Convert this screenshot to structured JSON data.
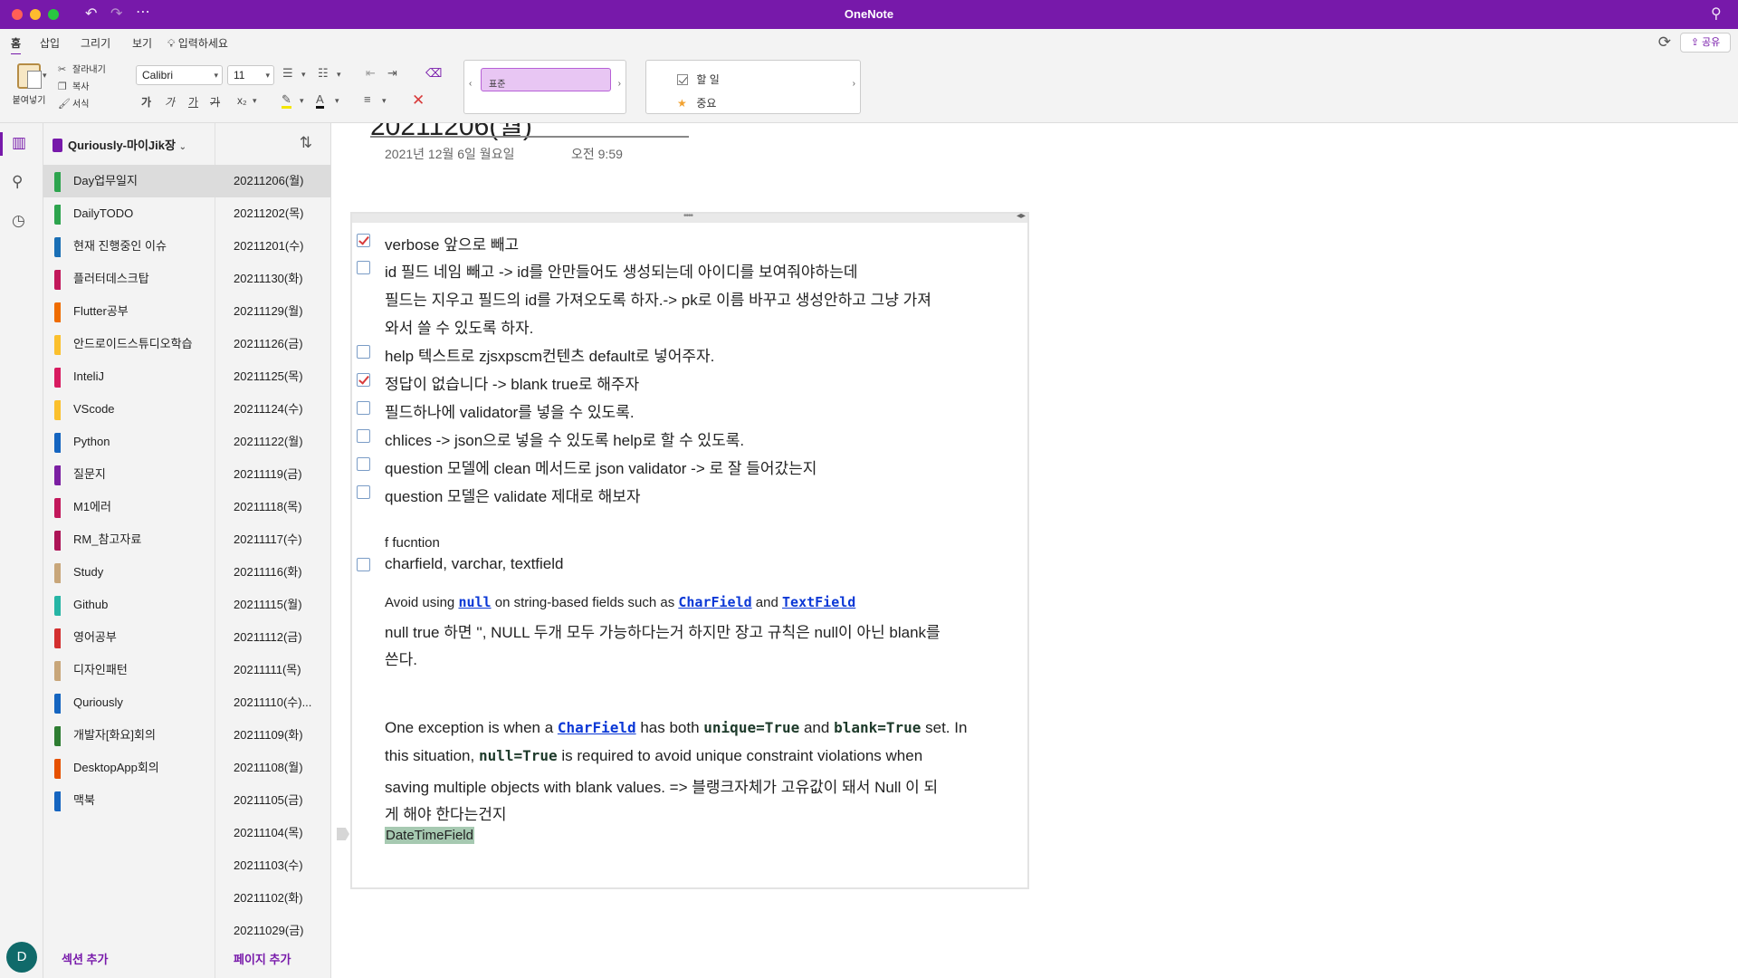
{
  "app": {
    "title": "OneNote"
  },
  "ribbon_tabs": [
    "홈",
    "삽입",
    "그리기",
    "보기"
  ],
  "tell_me": "입력하세요",
  "share_label": "공유",
  "clipboard": {
    "paste": "붙여넣기",
    "cut": "잘라내기",
    "copy": "복사",
    "format": "서식"
  },
  "font": {
    "family": "Calibri",
    "size": "11"
  },
  "format_buttons": [
    "가",
    "가",
    "가",
    "가",
    "x₂"
  ],
  "styles": {
    "selected": "표준"
  },
  "tags": [
    {
      "label": "할 일",
      "icon": "checkbox-icon"
    },
    {
      "label": "중요",
      "icon": "star-icon"
    }
  ],
  "notebook": {
    "name": "Quriously-마이Jik장"
  },
  "sections": [
    {
      "name": "Day업무일지",
      "color": "#2da44e"
    },
    {
      "name": "DailyTODO",
      "color": "#2da44e"
    },
    {
      "name": "현재 진행중인 이슈",
      "color": "#1a6fb5"
    },
    {
      "name": "플러터데스크탑",
      "color": "#c2185b"
    },
    {
      "name": "Flutter공부",
      "color": "#ef6c00"
    },
    {
      "name": "안드로이드스튜디오학습",
      "color": "#fbc02d"
    },
    {
      "name": "InteliJ",
      "color": "#d81b60"
    },
    {
      "name": "VScode",
      "color": "#fbc02d"
    },
    {
      "name": "Python",
      "color": "#1565c0"
    },
    {
      "name": "질문지",
      "color": "#7b1fa2"
    },
    {
      "name": "M1에러",
      "color": "#c2185b"
    },
    {
      "name": "RM_참고자료",
      "color": "#ad1457"
    },
    {
      "name": "Study",
      "color": "#c8a67a"
    },
    {
      "name": "Github",
      "color": "#26b5a5"
    },
    {
      "name": "영어공부",
      "color": "#d32f2f"
    },
    {
      "name": "디자인패턴",
      "color": "#c8a67a"
    },
    {
      "name": "Quriously",
      "color": "#1565c0"
    },
    {
      "name": "개발자[화요]회의",
      "color": "#2e7d32"
    },
    {
      "name": "DesktopApp회의",
      "color": "#e65100"
    },
    {
      "name": "맥북",
      "color": "#1565c0"
    }
  ],
  "add_section": "섹션 추가",
  "pages": [
    "20211206(월)",
    "20211202(목)",
    "20211201(수)",
    "20211130(화)",
    "20211129(월)",
    "20211126(금)",
    "20211125(목)",
    "20211124(수)",
    "20211122(월)",
    "20211119(금)",
    "20211118(목)",
    "20211117(수)",
    "20211116(화)",
    "20211115(월)",
    "20211112(금)",
    "20211111(목)",
    "20211110(수)...",
    "20211109(화)",
    "20211108(월)",
    "20211105(금)",
    "20211104(목)",
    "20211103(수)",
    "20211102(화)",
    "20211029(금)"
  ],
  "add_page": "페이지 추가",
  "page": {
    "title": "20211206(월)",
    "date": "2021년 12월 6일 월요일",
    "time": "오전 9:59"
  },
  "note": {
    "todo_1": "verbose 앞으로 빼고",
    "todo_2": "id 필드 네임 빼고 -> id를 안만들어도 생성되는데 아이디를 보여줘야하는데",
    "todo_2_cont_1": "필드는 지우고 필드의 id를 가져오도록 하자.-> pk로 이름 바꾸고 생성안하고 그냥 가져",
    "todo_2_cont_2": "와서 쓸 수 있도록 하자.",
    "todo_3": "help 텍스트로 zjsxpscm컨텐츠 default로 넣어주자.",
    "todo_4": "정답이 없습니다 -> blank true로 해주자",
    "todo_5": "필드하나에 validator를 넣을 수 있도록.",
    "todo_6": "chlices -> json으로 넣을 수 있도록 help로 할 수 있도록.",
    "todo_7": "question 모델에 clean 메서드로 json validator -> 로 잘 들어갔는지",
    "todo_8": "question 모델은 validate 제대로 해보자",
    "fn_label": "f fucntion",
    "fn_types": "charfield, varchar, textfield",
    "avoid_prefix": "Avoid using ",
    "avoid_null": "null",
    "avoid_mid": " on string-based fields such as ",
    "avoid_charfield": "CharField",
    "avoid_and": " and ",
    "avoid_textfield": "TextField",
    "null_line_1": "null true 하면 '', NULL 두개 모두 가능하다는거 하지만 장고 규칙은 null이 아닌 blank를",
    "null_line_2": "쓴다.",
    "exc_prefix": "One exception is when a ",
    "exc_charfield": "CharField",
    "exc_mid": " has both ",
    "exc_unique": "unique=True",
    "exc_and": " and ",
    "exc_blank": "blank=True",
    "exc_end": " set. In",
    "exc2_prefix": "this situation, ",
    "exc2_null": "null=True",
    "exc2_rest": " is required to avoid unique constraint violations when",
    "exc3": "saving multiple objects with blank values. => 블랭크자체가 고유값이 돼서 Null 이 되",
    "exc4": "게 해야 한다는건지",
    "datetime": "DateTimeField"
  }
}
